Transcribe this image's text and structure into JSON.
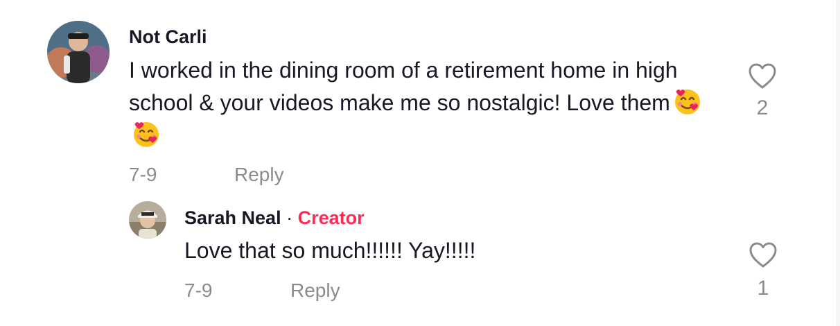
{
  "comments": [
    {
      "username": "Not Carli",
      "text": "I worked in the dining room of a retirement home in high school & your videos make me so nostalgic! Love them",
      "emojis": [
        "🥰",
        "🥰"
      ],
      "date": "7-9",
      "reply_label": "Reply",
      "like_count": "2"
    }
  ],
  "replies": [
    {
      "username": "Sarah Neal",
      "separator": "·",
      "badge": "Creator",
      "text": "Love that so much!!!!!! Yay!!!!!",
      "date": "7-9",
      "reply_label": "Reply",
      "like_count": "1"
    }
  ],
  "colors": {
    "text": "#161823",
    "muted": "#8a8b91",
    "creator_badge": "#fe2c55"
  }
}
